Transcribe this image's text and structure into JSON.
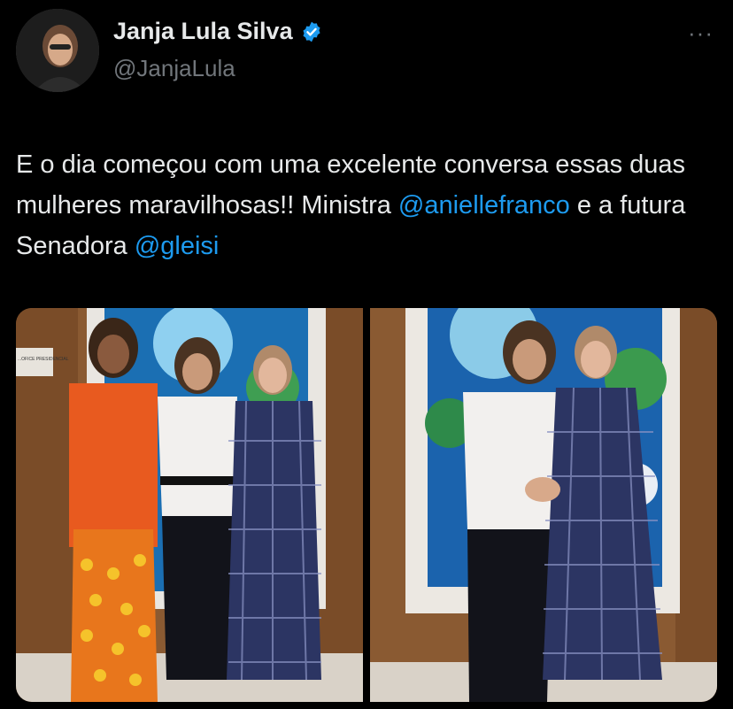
{
  "author": {
    "display_name": "Janja Lula Silva",
    "handle": "@JanjaLula",
    "verified_icon": "verified-badge-icon",
    "avatar_icon": "avatar"
  },
  "menu": {
    "more_label": "···"
  },
  "tweet": {
    "segments": [
      {
        "type": "text",
        "value": "E o dia começou com uma excelente conversa essas duas mulheres maravilhosas!! Ministra "
      },
      {
        "type": "mention",
        "value": "@aniellefranco"
      },
      {
        "type": "text",
        "value": " e a futura Senadora "
      },
      {
        "type": "mention",
        "value": "@gleisi"
      }
    ]
  },
  "media": {
    "photos": [
      {
        "name": "photo-three-women",
        "sign_text": "...OFICE PRESIDENCIAL"
      },
      {
        "name": "photo-two-women-holding-hands"
      }
    ]
  },
  "colors": {
    "accent": "#1d9bf0",
    "muted": "#71767b",
    "text": "#e7e9ea",
    "background": "#000000"
  }
}
